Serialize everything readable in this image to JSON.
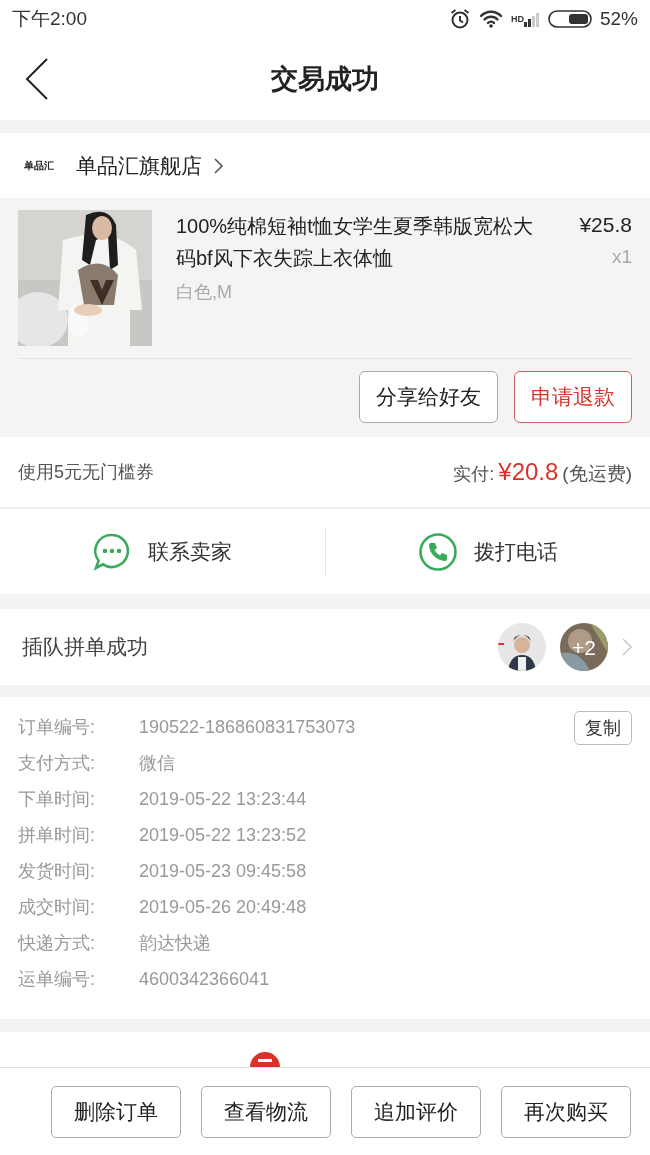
{
  "status_bar": {
    "time": "下午2:00",
    "network_label": "HD",
    "battery": "52%"
  },
  "header": {
    "title": "交易成功"
  },
  "store": {
    "logo_text": "单品汇",
    "name": "单品汇旗舰店"
  },
  "product": {
    "title": "100%纯棉短袖t恤女学生夏季韩版宽松大码bf风下衣失踪上衣体恤",
    "variant": "白色,M",
    "price": "¥25.8",
    "quantity": "x1"
  },
  "product_actions": [
    {
      "label": "分享给好友",
      "kind": "plain"
    },
    {
      "label": "申请退款",
      "kind": "accent"
    }
  ],
  "payment": {
    "coupon": "使用5元无门槛券",
    "paid_label": "实付:",
    "paid_amount": "¥20.8",
    "shipping_note": "(免运费)"
  },
  "contact_actions": [
    {
      "label": "联系卖家",
      "kind": "chat"
    },
    {
      "label": "拨打电话",
      "kind": "phone"
    }
  ],
  "group_buy": {
    "status": "插队拼单成功",
    "extra_count": "+2"
  },
  "order_info": [
    {
      "label": "订单编号:",
      "value": "190522-186860831753073",
      "copy_button": "复制"
    },
    {
      "label": "支付方式:",
      "value": "微信"
    },
    {
      "label": "下单时间:",
      "value": "2019-05-22 13:23:44"
    },
    {
      "label": "拼单时间:",
      "value": "2019-05-22 13:23:52"
    },
    {
      "label": "发货时间:",
      "value": "2019-05-23 09:45:58"
    },
    {
      "label": "成交时间:",
      "value": "2019-05-26 20:49:48"
    },
    {
      "label": "快递方式:",
      "value": "韵达快递"
    },
    {
      "label": "运单编号:",
      "value": "4600342366041"
    }
  ],
  "bottom_actions": [
    "删除订单",
    "查看物流",
    "追加评价",
    "再次购买"
  ]
}
